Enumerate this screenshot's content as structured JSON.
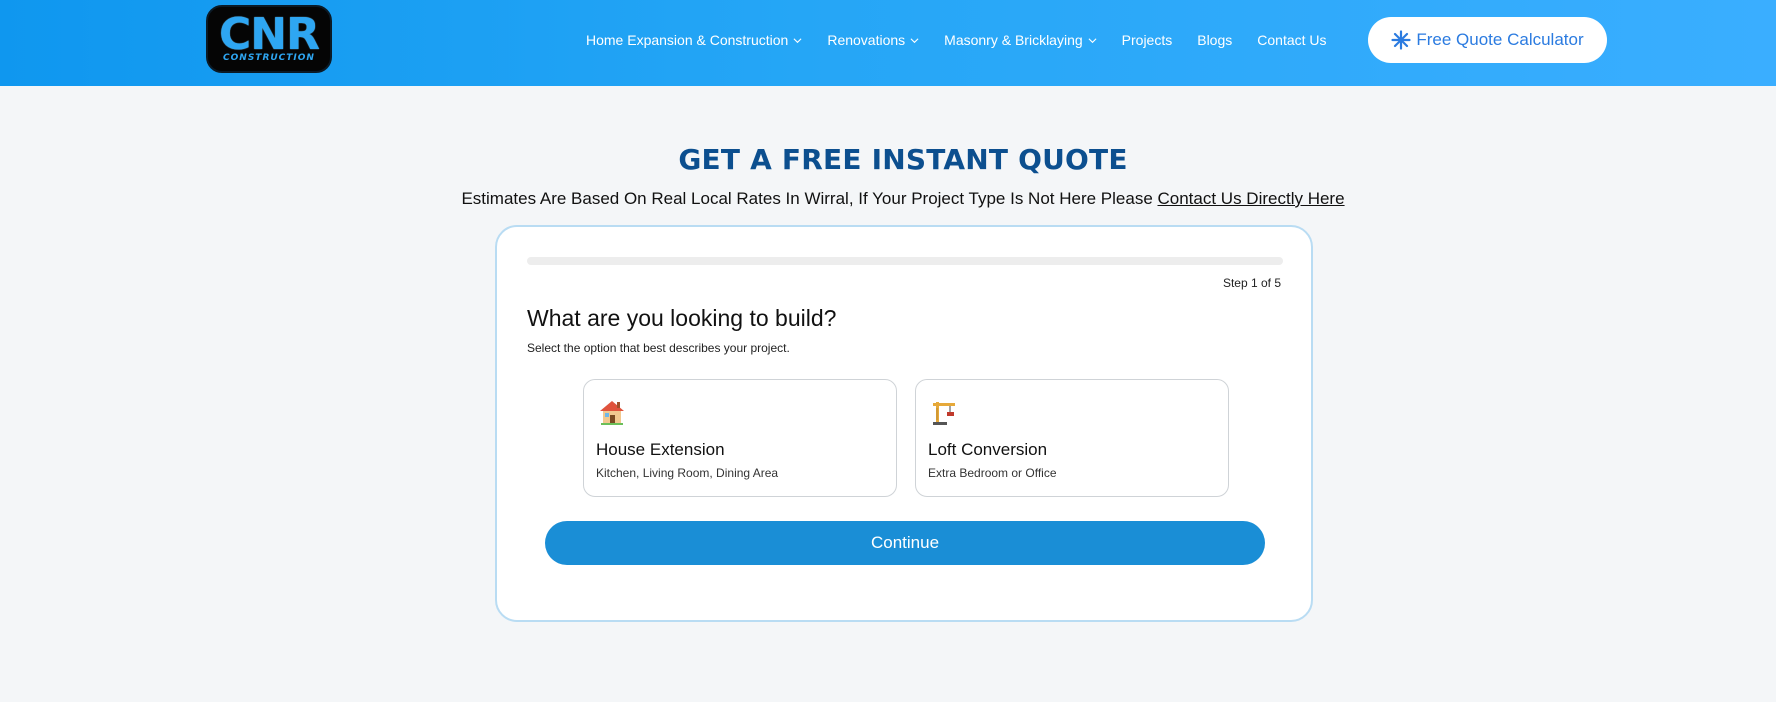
{
  "header": {
    "logo": {
      "main": "CNR",
      "sub": "CONSTRUCTION"
    },
    "nav": [
      {
        "label": "Home Expansion & Construction",
        "has_dropdown": true
      },
      {
        "label": "Renovations",
        "has_dropdown": true
      },
      {
        "label": "Masonry & Bricklaying",
        "has_dropdown": true
      },
      {
        "label": "Projects",
        "has_dropdown": false
      },
      {
        "label": "Blogs",
        "has_dropdown": false
      },
      {
        "label": "Contact Us",
        "has_dropdown": false
      }
    ],
    "cta_label": "Free Quote Calculator",
    "cta_icon": "sparkle-icon"
  },
  "main": {
    "title": "GET A FREE INSTANT QUOTE",
    "subtitle_text": "Estimates Are Based On Real Local Rates In Wirral, If Your Project Type Is Not Here Please ",
    "subtitle_link": "Contact Us Directly Here"
  },
  "form": {
    "progress_fraction": 0,
    "step_text": "Step 1 of 5",
    "question": "What are you looking to build?",
    "help": "Select the option that best describes your project.",
    "options": [
      {
        "icon": "house-icon",
        "title": "House Extension",
        "desc": "Kitchen, Living Room, Dining Area"
      },
      {
        "icon": "crane-icon",
        "title": "Loft Conversion",
        "desc": "Extra Bedroom or Office"
      }
    ],
    "continue_label": "Continue"
  },
  "colors": {
    "header_start": "#0f97ef",
    "header_end": "#3aaeff",
    "title": "#0c4f8f",
    "primary_button": "#1a8ed6",
    "cta_text": "#2b7be0",
    "card_border": "#b9dcf3"
  }
}
